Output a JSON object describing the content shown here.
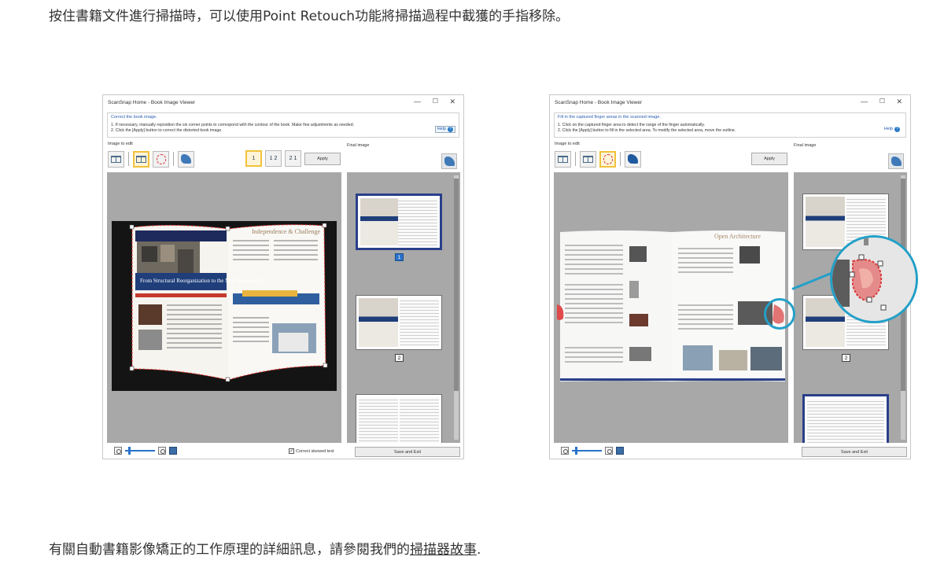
{
  "intro_text": "按住書籍文件進行掃描時，可以使用Point Retouch功能將掃描過程中截獲的手指移除。",
  "outro_prefix": "有關自動書籍影像矯正的工作原理的詳細訊息，請參閱我們的",
  "outro_link": "掃描器故事",
  "outro_suffix": ".",
  "windows": [
    {
      "title": "ScanSnap Home - Book Image Viewer",
      "instruction_head": "Correct the book image.",
      "instruction_line1": "1. If necessary, manually reposition the six corner points to correspond with the contour of the book. Make fine adjustments as needed.",
      "instruction_line2": "2. Click the [Apply] button to correct the distorted book image.",
      "help": "Help",
      "image_to_edit": "Image to edit",
      "final_image": "Final image",
      "apply": "Apply",
      "page_buttons": [
        "1",
        "1 2",
        "2 1"
      ],
      "correct_skewed": "Correct skewed text",
      "save_exit": "Save and Exit",
      "page_numbers": [
        "1",
        "2"
      ],
      "book_title": "Independence & Challenge",
      "book_subtitle": "From Structural Reorganization to the New Business Era"
    },
    {
      "title": "ScanSnap Home - Book Image Viewer",
      "instruction_head": "Fill in the captured finger areas in the scanned image.",
      "instruction_line1": "1. Click on the captured finger area to detect the range of the finger automatically.",
      "instruction_line2": "2. Click the [Apply] button to fill in the selected area. To modify the selected area, move the outline.",
      "help": "Help",
      "image_to_edit": "Image to edit",
      "final_image": "Final image",
      "apply": "Apply",
      "save_exit": "Save and Exit",
      "page_numbers": [
        "2"
      ],
      "book_title": "Open Architecture"
    }
  ],
  "colors": {
    "accent_blue": "#2a72c9",
    "selected_tool": "#f2c23a",
    "lens_ring": "#23a0c8",
    "finger_outline": "#d9383a",
    "viewer_bg": "#a8a8a8"
  }
}
